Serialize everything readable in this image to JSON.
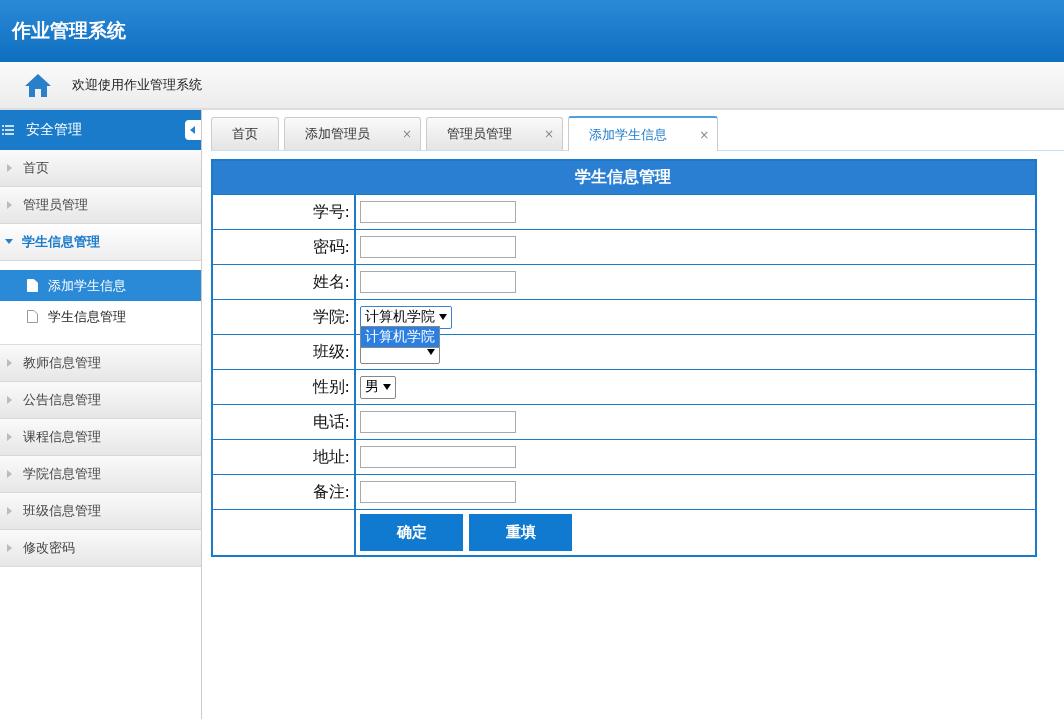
{
  "header": {
    "title": "作业管理系统"
  },
  "welcome": {
    "text": "欢迎使用作业管理系统"
  },
  "sidebar": {
    "title": "安全管理",
    "items": [
      {
        "label": "首页",
        "expanded": false
      },
      {
        "label": "管理员管理",
        "expanded": false
      },
      {
        "label": "学生信息管理",
        "expanded": true,
        "children": [
          {
            "label": "添加学生信息",
            "selected": true
          },
          {
            "label": "学生信息管理",
            "selected": false
          }
        ]
      },
      {
        "label": "教师信息管理",
        "expanded": false
      },
      {
        "label": "公告信息管理",
        "expanded": false
      },
      {
        "label": "课程信息管理",
        "expanded": false
      },
      {
        "label": "学院信息管理",
        "expanded": false
      },
      {
        "label": "班级信息管理",
        "expanded": false
      },
      {
        "label": "修改密码",
        "expanded": false
      }
    ]
  },
  "tabs": [
    {
      "label": "首页",
      "selected": false
    },
    {
      "label": "添加管理员",
      "selected": false,
      "close": "×"
    },
    {
      "label": "管理员管理",
      "selected": false,
      "close": "×"
    },
    {
      "label": "添加学生信息",
      "selected": true,
      "close": "×"
    }
  ],
  "form": {
    "title": "学生信息管理",
    "rows": [
      {
        "kind": "text",
        "label": "学号:"
      },
      {
        "kind": "text",
        "label": "密码:"
      },
      {
        "kind": "text",
        "label": "姓名:"
      },
      {
        "kind": "select",
        "label": "学院:",
        "value": "计算机学院",
        "open": true,
        "options": [
          {
            "label": "计算机学院",
            "selected": true
          }
        ]
      },
      {
        "kind": "select",
        "label": "班级:",
        "value": "",
        "open": false
      },
      {
        "kind": "select",
        "label": "性别:",
        "value": "男",
        "open": false
      },
      {
        "kind": "text",
        "label": "电话:"
      },
      {
        "kind": "text",
        "label": "地址:"
      },
      {
        "kind": "text",
        "label": "备注:"
      }
    ],
    "buttons": [
      "确定",
      "重填"
    ]
  }
}
